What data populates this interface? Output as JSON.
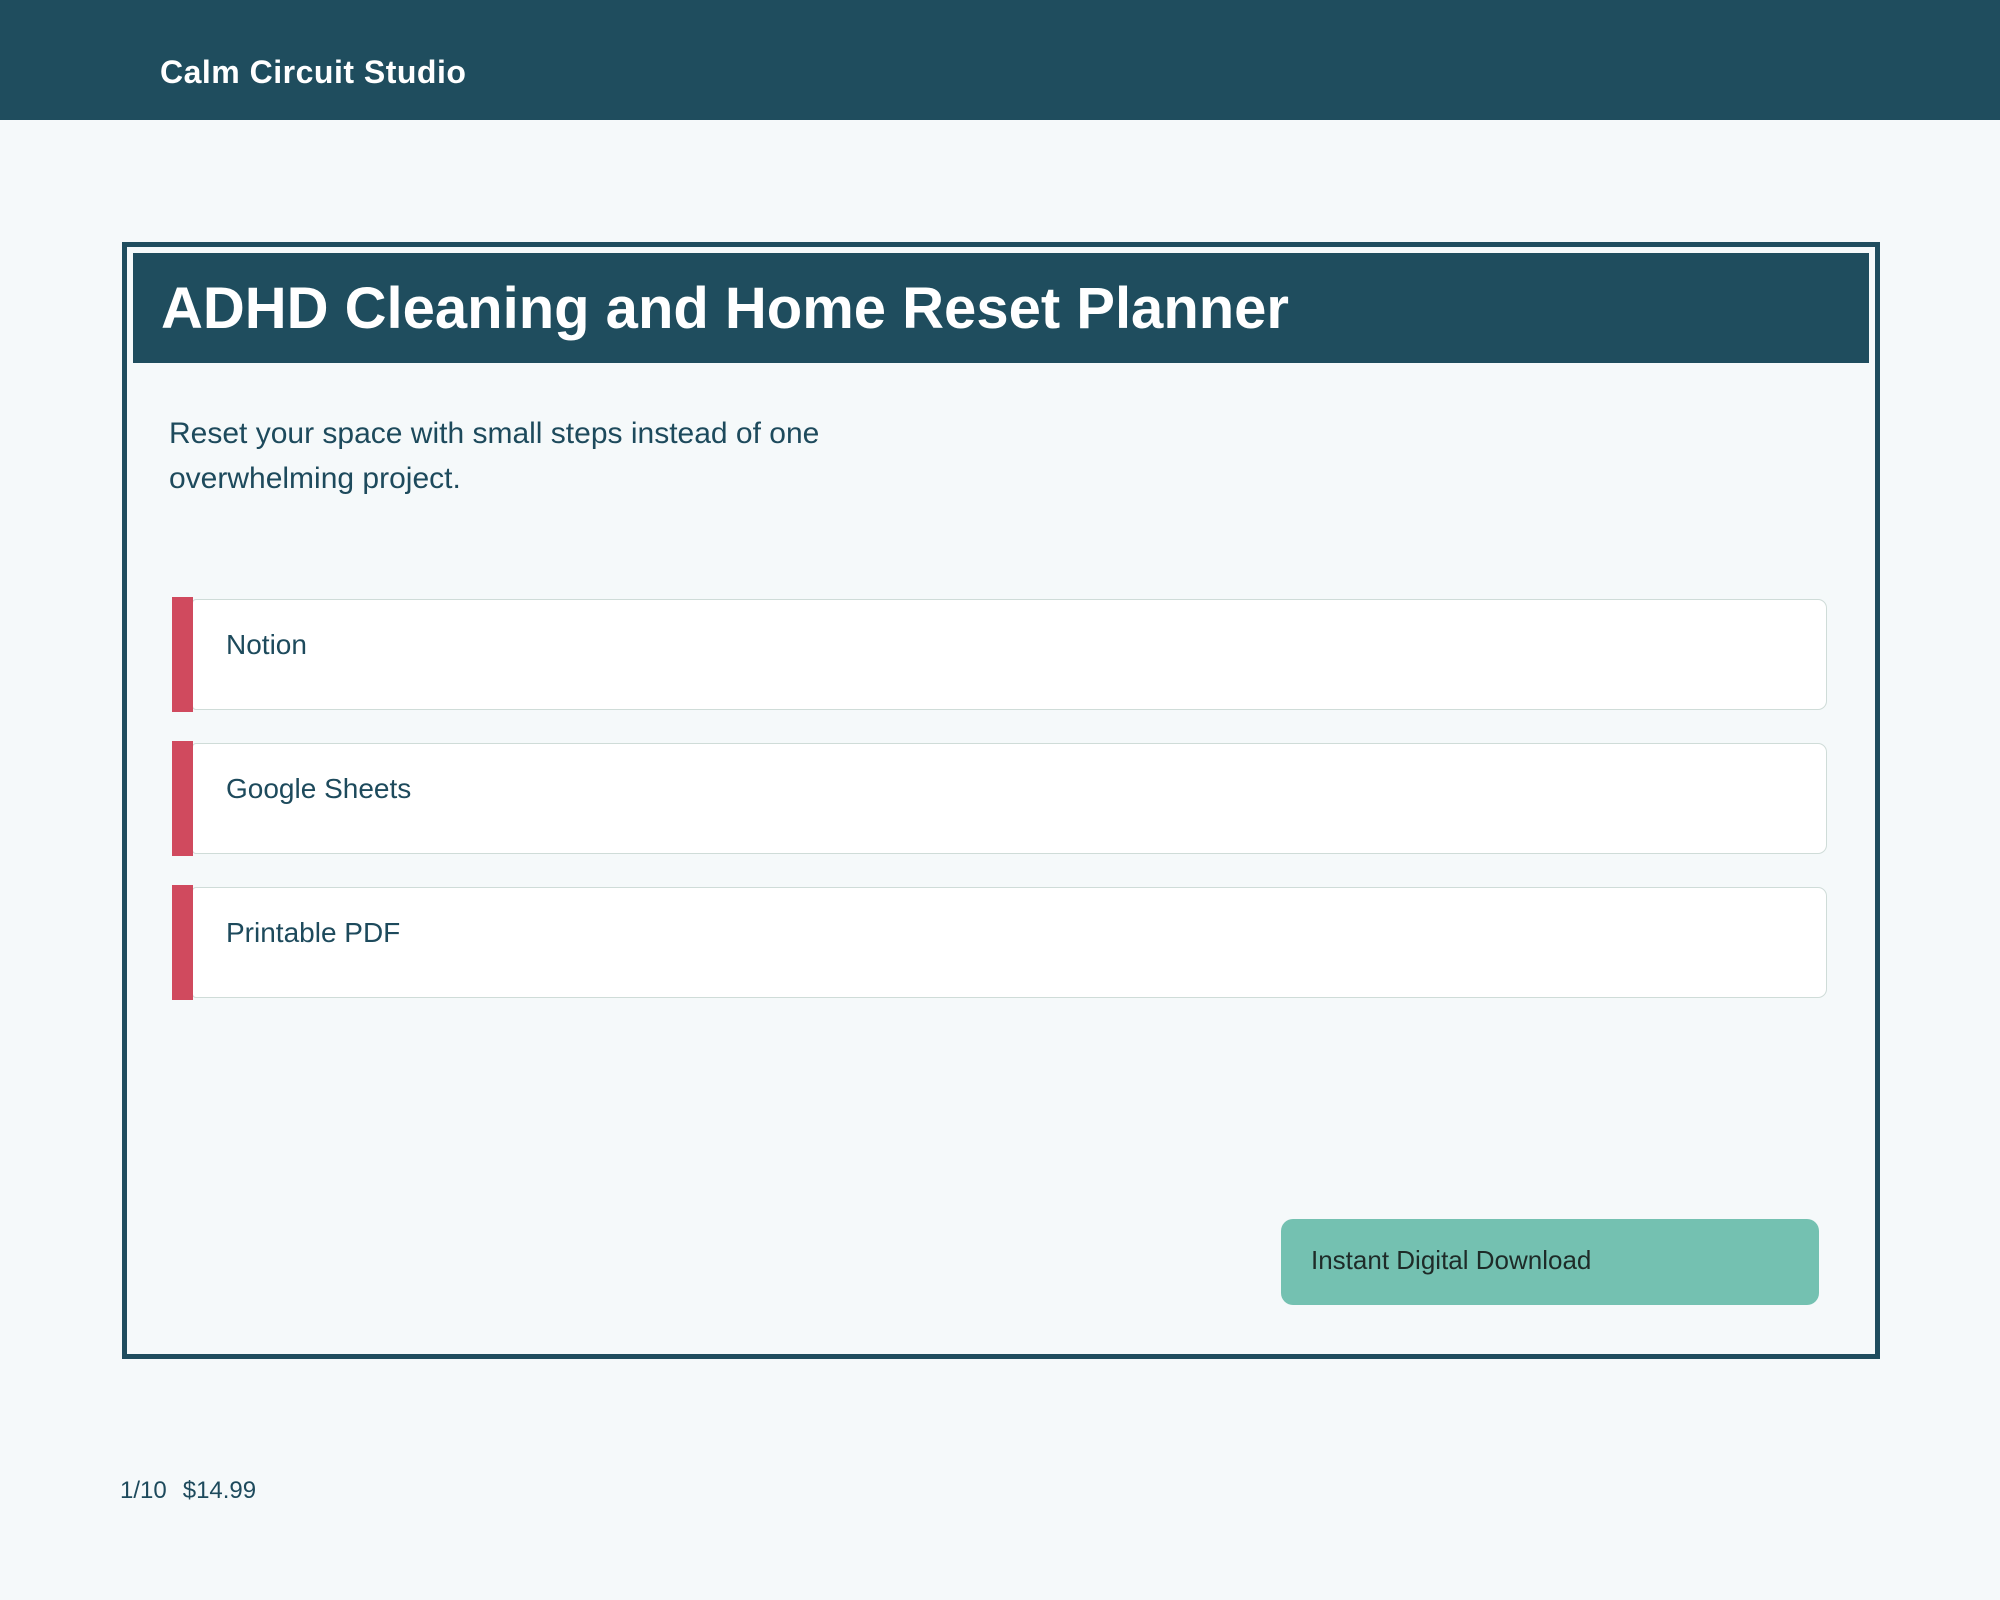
{
  "colors": {
    "header_bg": "#1f4d5e",
    "page_bg": "#f5f9fa",
    "ink": "#1d4a5c",
    "accent_red": "#d04a5e",
    "button_bg": "#74c1b1",
    "button_text": "#1e2b28",
    "item_border": "#cfdcd8",
    "title_text": "#ffffff"
  },
  "header": {
    "brand": "Calm Circuit Studio"
  },
  "product": {
    "title": "ADHD Cleaning and Home Reset Planner",
    "description": "Reset your space with small steps instead of one overwhelming project.",
    "formats": [
      {
        "label": "Notion"
      },
      {
        "label": "Google Sheets"
      },
      {
        "label": "Printable PDF"
      }
    ],
    "cta_label": "Instant Digital Download"
  },
  "footer": {
    "page_indicator": "1/10",
    "price": "$14.99"
  }
}
